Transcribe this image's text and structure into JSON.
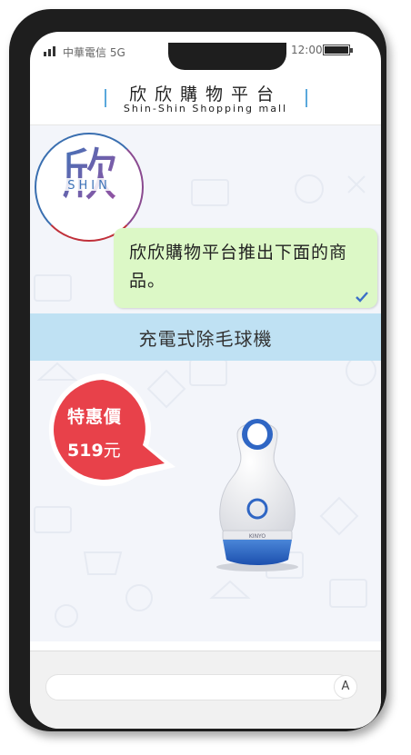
{
  "status_bar": {
    "carrier": "中華電信 5G",
    "time": "12:00"
  },
  "header": {
    "title_zh": "欣欣購物平台",
    "title_en": "Shin-Shin Shopping mall"
  },
  "avatar": {
    "logo_text": "欣",
    "logo_sub": "SHIN"
  },
  "message": {
    "text": "欣欣購物平台推出下面的商品。",
    "read_icon": "check-icon"
  },
  "product": {
    "name": "充電式除毛球機",
    "promo_label": "特惠價",
    "price": "519",
    "currency": "元",
    "brand": "KINYO"
  },
  "carousel": {
    "count": 4,
    "active": 0
  },
  "footer": {
    "input_button": "A"
  },
  "colors": {
    "accent_blue": "#5aa8dc",
    "bubble_green": "#dcf8c6",
    "banner_blue": "#bfe1f3",
    "tag_red": "#e8414a"
  }
}
